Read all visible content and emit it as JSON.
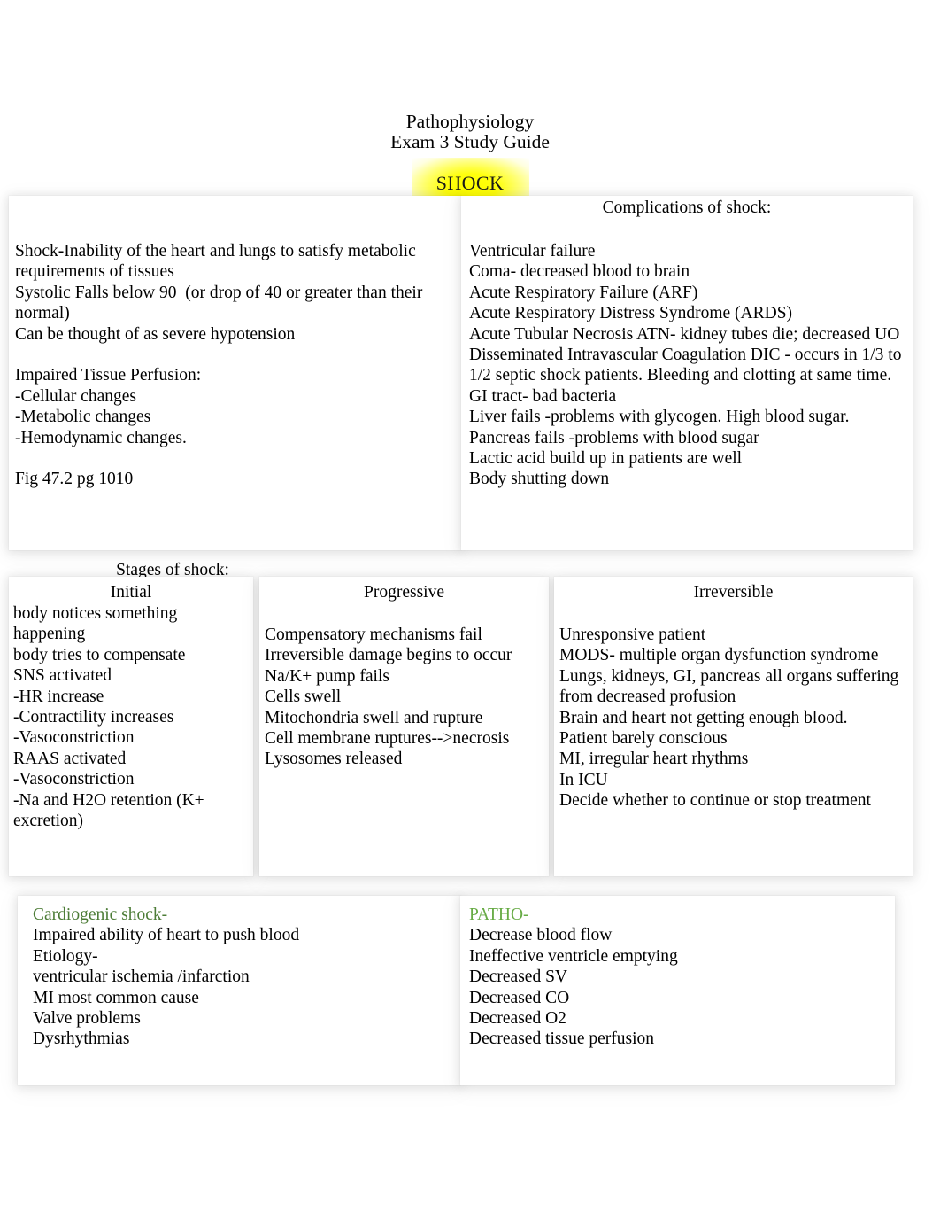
{
  "document": {
    "title_lines": [
      "Pathophysiology",
      "Exam 3 Study Guide"
    ],
    "main_heading": "SHOCK",
    "highlight_color": "#ffff00"
  },
  "section_definitions": {
    "shock_definition": "Shock-Inability of the heart and lungs to satisfy metabolic requirements of tissues\nSystolic Falls below 90  (or drop of 40 or greater than their normal)\nCan be thought of as severe hypotension\n\nImpaired Tissue Perfusion:\n-Cellular changes\n-Metabolic changes\n-Hemodynamic changes.\n\nFig 47.2 pg 1010",
    "complications_heading": "Complications of shock:",
    "complications_body": "Ventricular failure\nComa- decreased blood to brain\nAcute Respiratory Failure (ARF)\nAcute Respiratory Distress Syndrome (ARDS)\nAcute Tubular Necrosis ATN- kidney tubes die; decreased UO\nDisseminated Intravascular Coagulation DIC - occurs in 1/3 to 1/2 septic shock patients. Bleeding and clotting at same time.\nGI tract- bad bacteria\nLiver fails -problems with glycogen. High blood sugar.\nPancreas fails -problems with blood sugar\nLactic acid build up in patients are well\nBody shutting down"
  },
  "stages": {
    "caption": "Stages of shock:",
    "columns": [
      {
        "heading": "Initial",
        "body": "body notices something happening\nbody tries to compensate\nSNS activated\n-HR increase\n-Contractility increases\n-Vasoconstriction\nRAAS activated\n-Vasoconstriction\n-Na and H2O retention (K+ excretion)"
      },
      {
        "heading": "Progressive",
        "body": "Compensatory mechanisms fail\nIrreversible damage begins to occur\nNa/K+ pump fails\nCells swell\nMitochondria swell and rupture\nCell membrane ruptures-->necrosis\nLysosomes released"
      },
      {
        "heading": "Irreversible",
        "body": "Unresponsive patient\nMODS- multiple organ dysfunction syndrome\nLungs, kidneys, GI, pancreas all organs suffering from decreased profusion\nBrain and heart not getting enough blood.\nPatient barely conscious\nMI, irregular heart rhythms\nIn ICU\nDecide whether to continue or stop treatment"
      }
    ]
  },
  "cardiogenic": {
    "left_title": "Cardiogenic shock-",
    "left_title_color": "#4c7c36",
    "left_body": "Impaired ability of heart to push blood\nEtiology-\nventricular ischemia /infarction\nMI most common cause\nValve problems\nDysrhythmias",
    "right_title": "PATHO-",
    "right_title_color": "#67ab45",
    "right_body": "Decrease blood flow\nIneffective ventricle emptying\nDecreased SV\nDecreased CO\nDecreased O2\nDecreased tissue perfusion"
  }
}
